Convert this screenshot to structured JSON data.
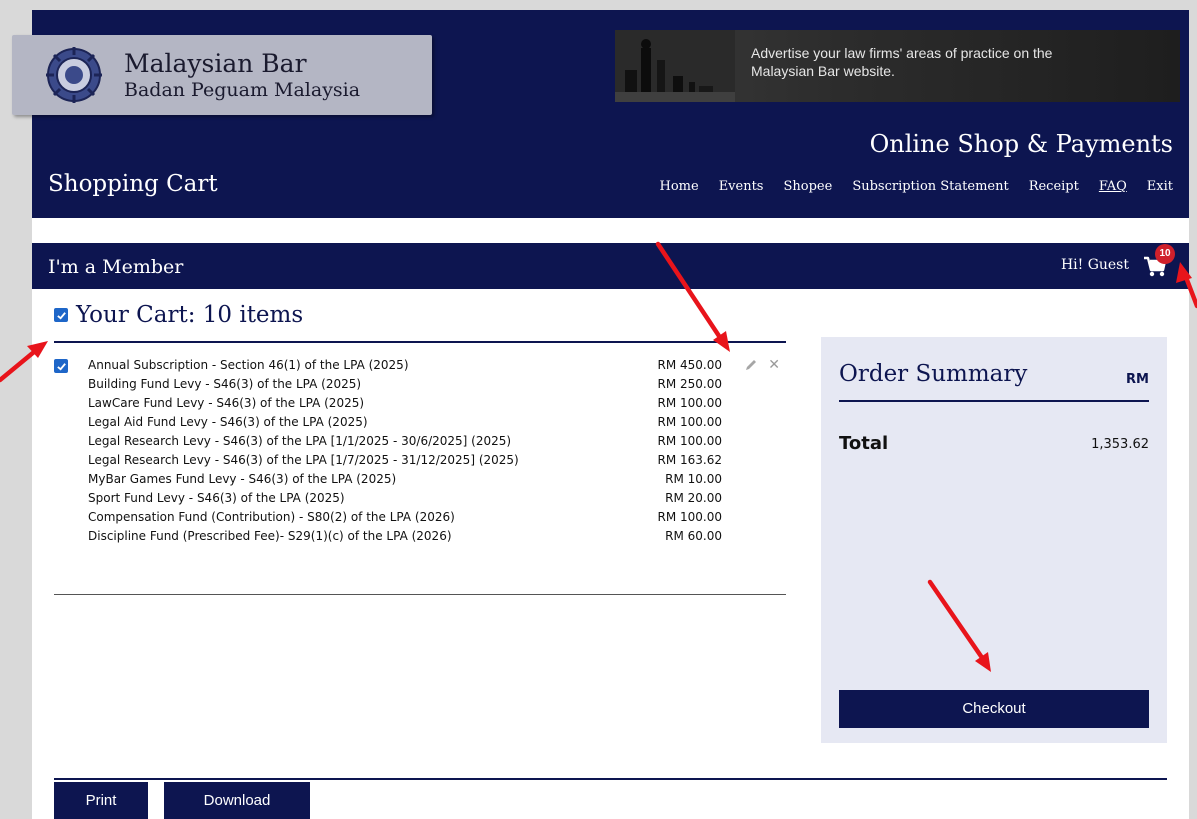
{
  "header": {
    "org_name": "Malaysian Bar",
    "org_subname": "Badan Peguam Malaysia",
    "ad_text": "Advertise your law firms' areas of practice on the Malaysian Bar website.",
    "shop_title": "Online Shop & Payments",
    "page_title": "Shopping Cart",
    "nav": [
      "Home",
      "Events",
      "Shopee",
      "Subscription Statement",
      "Receipt",
      "FAQ",
      "Exit"
    ]
  },
  "member_bar": {
    "title": "I'm a Member",
    "greeting": "Hi! Guest",
    "cart_count": "10"
  },
  "cart": {
    "heading": "Your Cart: 10 items",
    "items": [
      {
        "name": "Annual Subscription - Section 46(1) of the LPA (2025)",
        "price": "RM 450.00"
      },
      {
        "name": "Building Fund Levy - S46(3) of the LPA (2025)",
        "price": "RM 250.00"
      },
      {
        "name": "LawCare Fund Levy - S46(3) of the LPA (2025)",
        "price": "RM 100.00"
      },
      {
        "name": "Legal Aid Fund Levy - S46(3) of the LPA (2025)",
        "price": "RM 100.00"
      },
      {
        "name": "Legal Research Levy - S46(3) of the LPA [1/1/2025 - 30/6/2025] (2025)",
        "price": "RM 100.00"
      },
      {
        "name": "Legal Research Levy - S46(3) of the LPA [1/7/2025 - 31/12/2025] (2025)",
        "price": "RM 163.62"
      },
      {
        "name": "MyBar Games Fund Levy - S46(3) of the LPA (2025)",
        "price": "RM 10.00"
      },
      {
        "name": "Sport Fund Levy - S46(3) of the LPA (2025)",
        "price": "RM 20.00"
      },
      {
        "name": "Compensation Fund (Contribution) - S80(2) of the LPA (2026)",
        "price": "RM 100.00"
      },
      {
        "name": "Discipline Fund (Prescribed Fee)- S29(1)(c) of the LPA (2026)",
        "price": "RM 60.00"
      }
    ]
  },
  "summary": {
    "title": "Order Summary",
    "currency": "RM",
    "total_label": "Total",
    "total_value": "1,353.62",
    "checkout_label": "Checkout"
  },
  "footer": {
    "print_label": "Print",
    "download_label": "Download"
  },
  "colors": {
    "navy": "#0d1550",
    "summary_bg": "#e6e8f3",
    "badge": "#d0202b",
    "checkbox": "#1e66c8",
    "annotation_arrow": "#e8141b"
  },
  "icons": [
    "bar-emblem-icon",
    "cart-icon",
    "checkbox-icon",
    "pencil-icon",
    "close-icon",
    "annotation-arrow"
  ]
}
